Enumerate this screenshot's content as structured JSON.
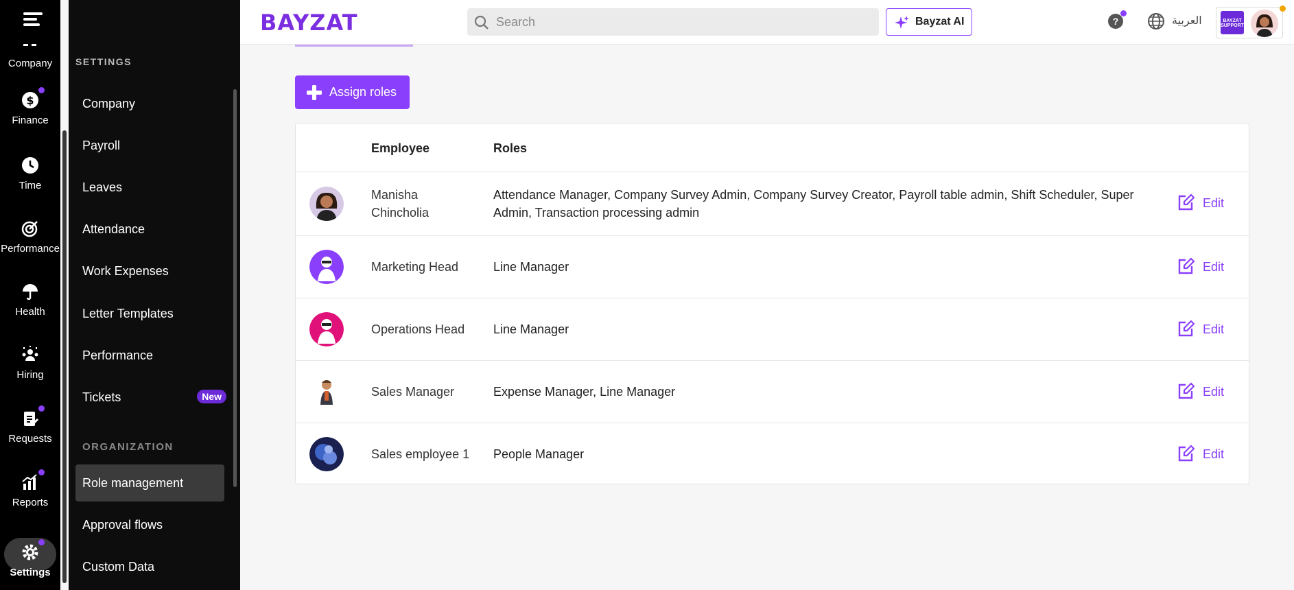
{
  "rail": {
    "items": [
      {
        "label": "Company",
        "icon": "company-icon"
      },
      {
        "label": "Finance",
        "icon": "dollar-icon",
        "dot": true
      },
      {
        "label": "Time",
        "icon": "clock-icon"
      },
      {
        "label": "Performance",
        "icon": "target-icon"
      },
      {
        "label": "Health",
        "icon": "umbrella-icon"
      },
      {
        "label": "Hiring",
        "icon": "people-icon"
      },
      {
        "label": "Requests",
        "icon": "clipboard-icon",
        "dot": true
      },
      {
        "label": "Reports",
        "icon": "chart-icon",
        "dot": true
      },
      {
        "label": "Settings",
        "icon": "gear-icon",
        "dot": true
      }
    ]
  },
  "panel": {
    "heading": "SETTINGS",
    "items": [
      "Company",
      "Payroll",
      "Leaves",
      "Attendance",
      "Work Expenses",
      "Letter Templates",
      "Performance",
      "Tickets"
    ],
    "tickets_badge": "New",
    "org_heading": "ORGANIZATION",
    "org_items": [
      "Role management",
      "Approval flows",
      "Custom Data"
    ]
  },
  "topbar": {
    "brand": "BAYZAT",
    "search_placeholder": "Search",
    "ai_label": "Bayzat AI",
    "help": "?",
    "language": "العربية",
    "company_logo_text": "BAYZAT SUPPORT"
  },
  "main": {
    "assign_label": "Assign roles",
    "headers": {
      "employee": "Employee",
      "roles": "Roles"
    },
    "edit_label": "Edit",
    "rows": [
      {
        "employee": "Manisha Chincholia",
        "roles": "Attendance Manager, Company Survey Admin, Company Survey Creator, Payroll table admin, Shift Scheduler, Super Admin, Transaction processing admin",
        "avatar_color": "#d7c9e6"
      },
      {
        "employee": "Marketing Head",
        "roles": "Line Manager",
        "avatar_color": "#8a3ffc"
      },
      {
        "employee": "Operations Head",
        "roles": "Line Manager",
        "avatar_color": "#e0127a"
      },
      {
        "employee": "Sales Manager",
        "roles": "Expense Manager, Line Manager",
        "avatar_color": "#ffffff"
      },
      {
        "employee": "Sales employee 1",
        "roles": "People Manager",
        "avatar_color": "#2a3d8f"
      }
    ]
  },
  "colors": {
    "accent": "#8a3ffc",
    "rail_bg": "#000000",
    "panel_bg": "#0d0d0d"
  }
}
